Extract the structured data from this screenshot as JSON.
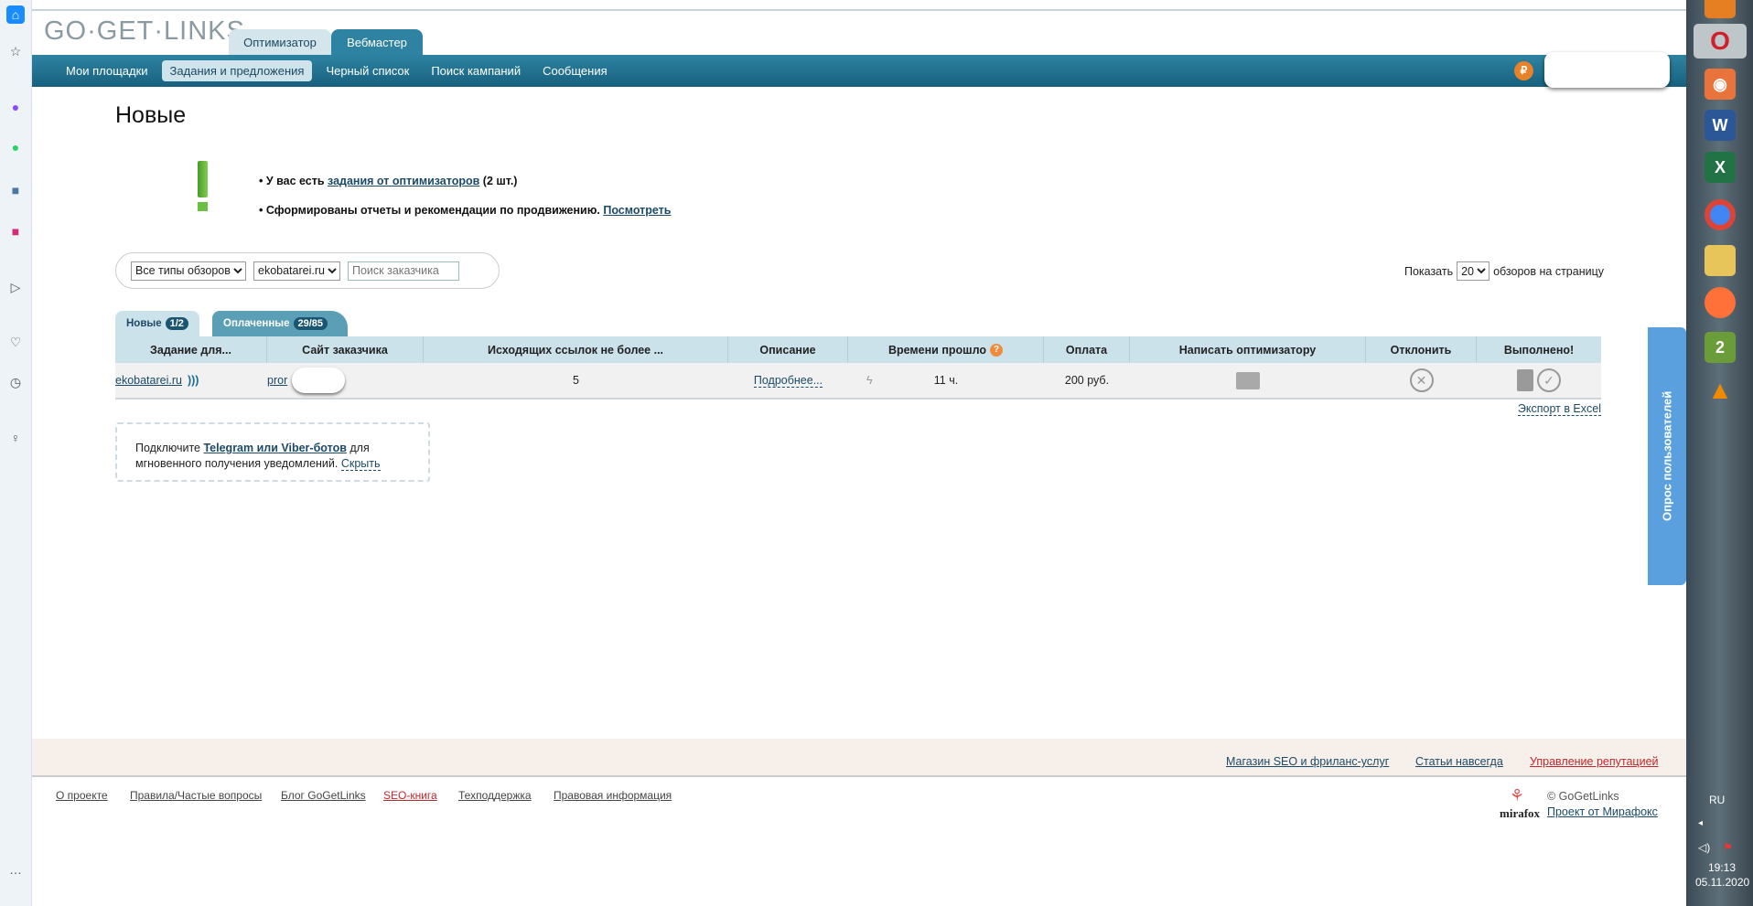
{
  "header": {
    "logo": "GO·GET·LINKS",
    "tabs": [
      "Оптимизатор",
      "Вебмастер"
    ],
    "active_tab": "Вебмастер"
  },
  "nav": {
    "items": [
      "Мои площадки",
      "Задания и предложения",
      "Черный список",
      "Поиск кампаний",
      "Сообщения"
    ],
    "active": "Задания и предложения"
  },
  "page": {
    "title": "Новые"
  },
  "notices": {
    "n1_pre": "У вас есть ",
    "n1_link": "задания от оптимизаторов",
    "n1_post": " (2 шт.)",
    "n2_pre": "Сформированы отчеты и рекомендации по продвижению. ",
    "n2_link": "Посмотреть"
  },
  "filter": {
    "type": "Все типы обзоров",
    "site": "ekobatarei.ru",
    "search_placeholder": "Поиск заказчика"
  },
  "perpage": {
    "pre": "Показать",
    "value": "20",
    "post": "обзоров на страницу"
  },
  "tabs": [
    {
      "label": "Новые",
      "count": "1/2"
    },
    {
      "label": "Оплаченные",
      "count": "29/85"
    }
  ],
  "table": {
    "headers": [
      "Задание для...",
      "Сайт заказчика",
      "Исходящих ссылок не более ...",
      "Описание",
      "Времени прошло",
      "Оплата",
      "Написать оптимизатору",
      "Отклонить",
      "Выполнено!"
    ],
    "rows": [
      {
        "site": "ekobatarei.ru",
        "customer": "pror",
        "links": "5",
        "desc": "Подробнее...",
        "time": "11 ч.",
        "pay": "200 руб."
      }
    ]
  },
  "export": "Экспорт в Excel",
  "telegram": {
    "pre": "Подключите ",
    "link": "Telegram или Viber-ботов",
    "post": " для мгновенного получения уведомлений. ",
    "hide": "Скрыть"
  },
  "survey": "Опрос пользователей",
  "footer": {
    "top_links": [
      "Магазин SEO и фриланс-услуг",
      "Статьи навсегда",
      "Управление репутацией"
    ],
    "links": [
      "О проекте",
      "Правила/Частые вопросы",
      "Блог GoGetLinks",
      "SEO-книга",
      "Техподдержка",
      "Правовая информация"
    ],
    "copyright": "© GoGetLinks",
    "project": "Проект от Мирафокс",
    "mirafox": "mirafox"
  },
  "taskbar": {
    "lang": "RU",
    "time": "19:13",
    "date": "05.11.2020"
  },
  "colors": {
    "nav": "#1f6d92",
    "accent_red": "#c0272d",
    "link": "#1c4a66"
  }
}
